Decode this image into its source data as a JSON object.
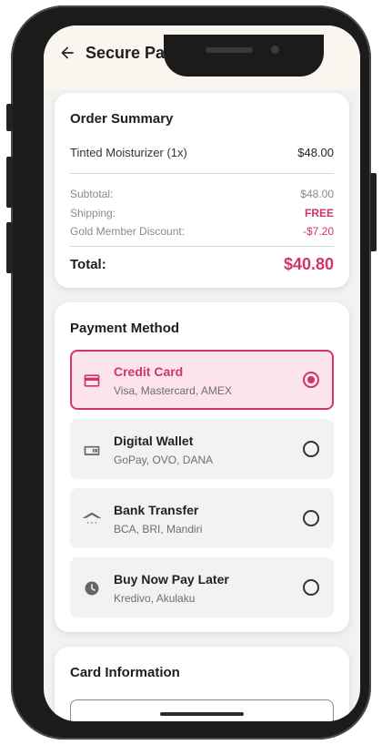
{
  "appbar": {
    "title": "Secure Payment"
  },
  "order_summary": {
    "title": "Order Summary",
    "item": {
      "name": "Tinted Moisturizer (1x)",
      "price": "$48.00"
    },
    "subtotal": {
      "label": "Subtotal:",
      "value": "$48.00"
    },
    "shipping": {
      "label": "Shipping:",
      "value": "FREE"
    },
    "discount": {
      "label": "Gold Member Discount:",
      "value": "-$7.20"
    },
    "total": {
      "label": "Total:",
      "value": "$40.80"
    }
  },
  "payment": {
    "title": "Payment Method",
    "methods": [
      {
        "name": "Credit Card",
        "desc": "Visa, Mastercard, AMEX",
        "icon": "credit-card-icon",
        "selected": true
      },
      {
        "name": "Digital Wallet",
        "desc": "GoPay, OVO, DANA",
        "icon": "wallet-icon",
        "selected": false
      },
      {
        "name": "Bank Transfer",
        "desc": "BCA, BRI, Mandiri",
        "icon": "bank-icon",
        "selected": false
      },
      {
        "name": "Buy Now Pay Later",
        "desc": "Kredivo, Akulaku",
        "icon": "clock-icon",
        "selected": false
      }
    ]
  },
  "card_info": {
    "title": "Card Information"
  },
  "colors": {
    "accent": "#d2336e",
    "selected_bg": "#fce4ec",
    "appbar_bg": "#fbf5ef"
  }
}
